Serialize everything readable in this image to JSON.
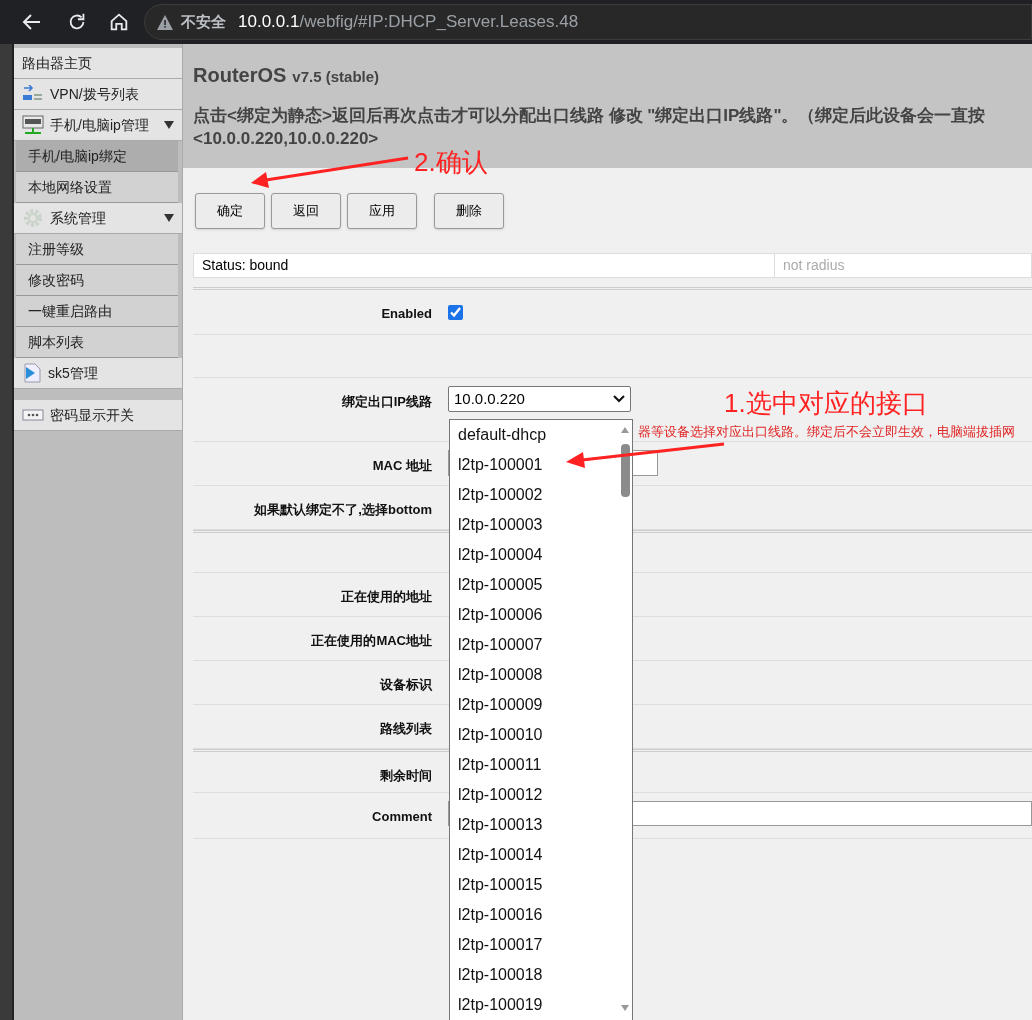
{
  "browser": {
    "security_label": "不安全",
    "url_host": "10.0.0.1",
    "url_path": "/webfig/#IP:DHCP_Server.Leases.48"
  },
  "sidebar": {
    "items": [
      {
        "label": "路由器主页",
        "kind": "plain",
        "selected": false
      },
      {
        "label": "VPN/拨号列表",
        "kind": "vpn",
        "selected": false
      },
      {
        "label": "手机/电脑ip管理",
        "kind": "ip",
        "selected": false,
        "expanded": true,
        "children": [
          {
            "label": "手机/电脑ip绑定",
            "selected": true
          },
          {
            "label": "本地网络设置",
            "selected": false
          }
        ]
      },
      {
        "label": "系统管理",
        "kind": "gear",
        "selected": false,
        "expanded": true,
        "children": [
          {
            "label": "注册等级",
            "selected": false
          },
          {
            "label": "修改密码",
            "selected": false
          },
          {
            "label": "一键重启路由",
            "selected": false
          },
          {
            "label": "脚本列表",
            "selected": false
          }
        ]
      },
      {
        "label": "sk5管理",
        "kind": "play",
        "selected": false
      },
      {
        "label": "密码显示开关",
        "kind": "dots",
        "selected": false
      }
    ]
  },
  "header": {
    "title": "RouterOS",
    "version": "v7.5 (stable)",
    "notice": [
      "点击<绑定为静态>返回后再次点击才可以分配出口线路 修改 \"绑定出口IP线路\"。（绑定后此设备会一直按",
      "<10.0.0.220,10.0.0.220>"
    ]
  },
  "buttons": [
    "确定",
    "返回",
    "应用",
    "删除"
  ],
  "status": {
    "text": "Status: bound",
    "radius": "not radius"
  },
  "form": [
    {
      "kind": "checkbox",
      "label": "Enabled",
      "checked": true
    },
    {
      "kind": "blank"
    },
    {
      "kind": "select",
      "label": "绑定出口IP线路",
      "value": "10.0.0.220",
      "hint": "器等设备选择对应出口线路。绑定后不会立即生效，电脑端拔插网"
    },
    {
      "kind": "input",
      "label": "MAC 地址"
    },
    {
      "kind": "hidden",
      "label": "如果默认绑定不了,选择bottom"
    },
    {
      "kind": "blank"
    },
    {
      "kind": "hidden",
      "label": "正在使用的地址"
    },
    {
      "kind": "hidden",
      "label": "正在使用的MAC地址"
    },
    {
      "kind": "hidden",
      "label": "设备标识"
    },
    {
      "kind": "hidden",
      "label": "路线列表"
    },
    {
      "kind": "hidden",
      "label": "剩余时间"
    },
    {
      "kind": "wide_input",
      "label": "Comment"
    }
  ],
  "dropdown": {
    "options": [
      "default-dhcp",
      "l2tp-100001",
      "l2tp-100002",
      "l2tp-100003",
      "l2tp-100004",
      "l2tp-100005",
      "l2tp-100006",
      "l2tp-100007",
      "l2tp-100008",
      "l2tp-100009",
      "l2tp-100010",
      "l2tp-100011",
      "l2tp-100012",
      "l2tp-100013",
      "l2tp-100014",
      "l2tp-100015",
      "l2tp-100016",
      "l2tp-100017",
      "l2tp-100018",
      "l2tp-100019"
    ]
  },
  "annotations": [
    "1.选中对应的接口",
    "2.确认"
  ]
}
